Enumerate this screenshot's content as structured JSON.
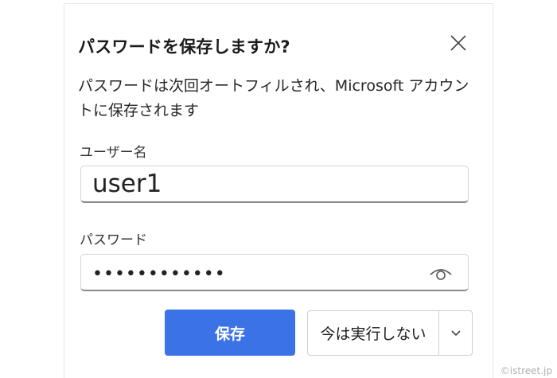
{
  "dialog": {
    "title": "パスワードを保存しますか?",
    "description": "パスワードは次回オートフィルされ、Microsoft アカウントに保存されます",
    "username": {
      "label": "ユーザー名",
      "value": "user1"
    },
    "password": {
      "label": "パスワード",
      "value": "••••••••••••"
    },
    "buttons": {
      "save": "保存",
      "not_now": "今は実行しない"
    },
    "icons": {
      "close": "close-icon",
      "show_password": "eye-icon",
      "dropdown": "chevron-down-icon"
    },
    "colors": {
      "primary": "#3b73e6"
    }
  },
  "watermark": "©istreet.jp"
}
